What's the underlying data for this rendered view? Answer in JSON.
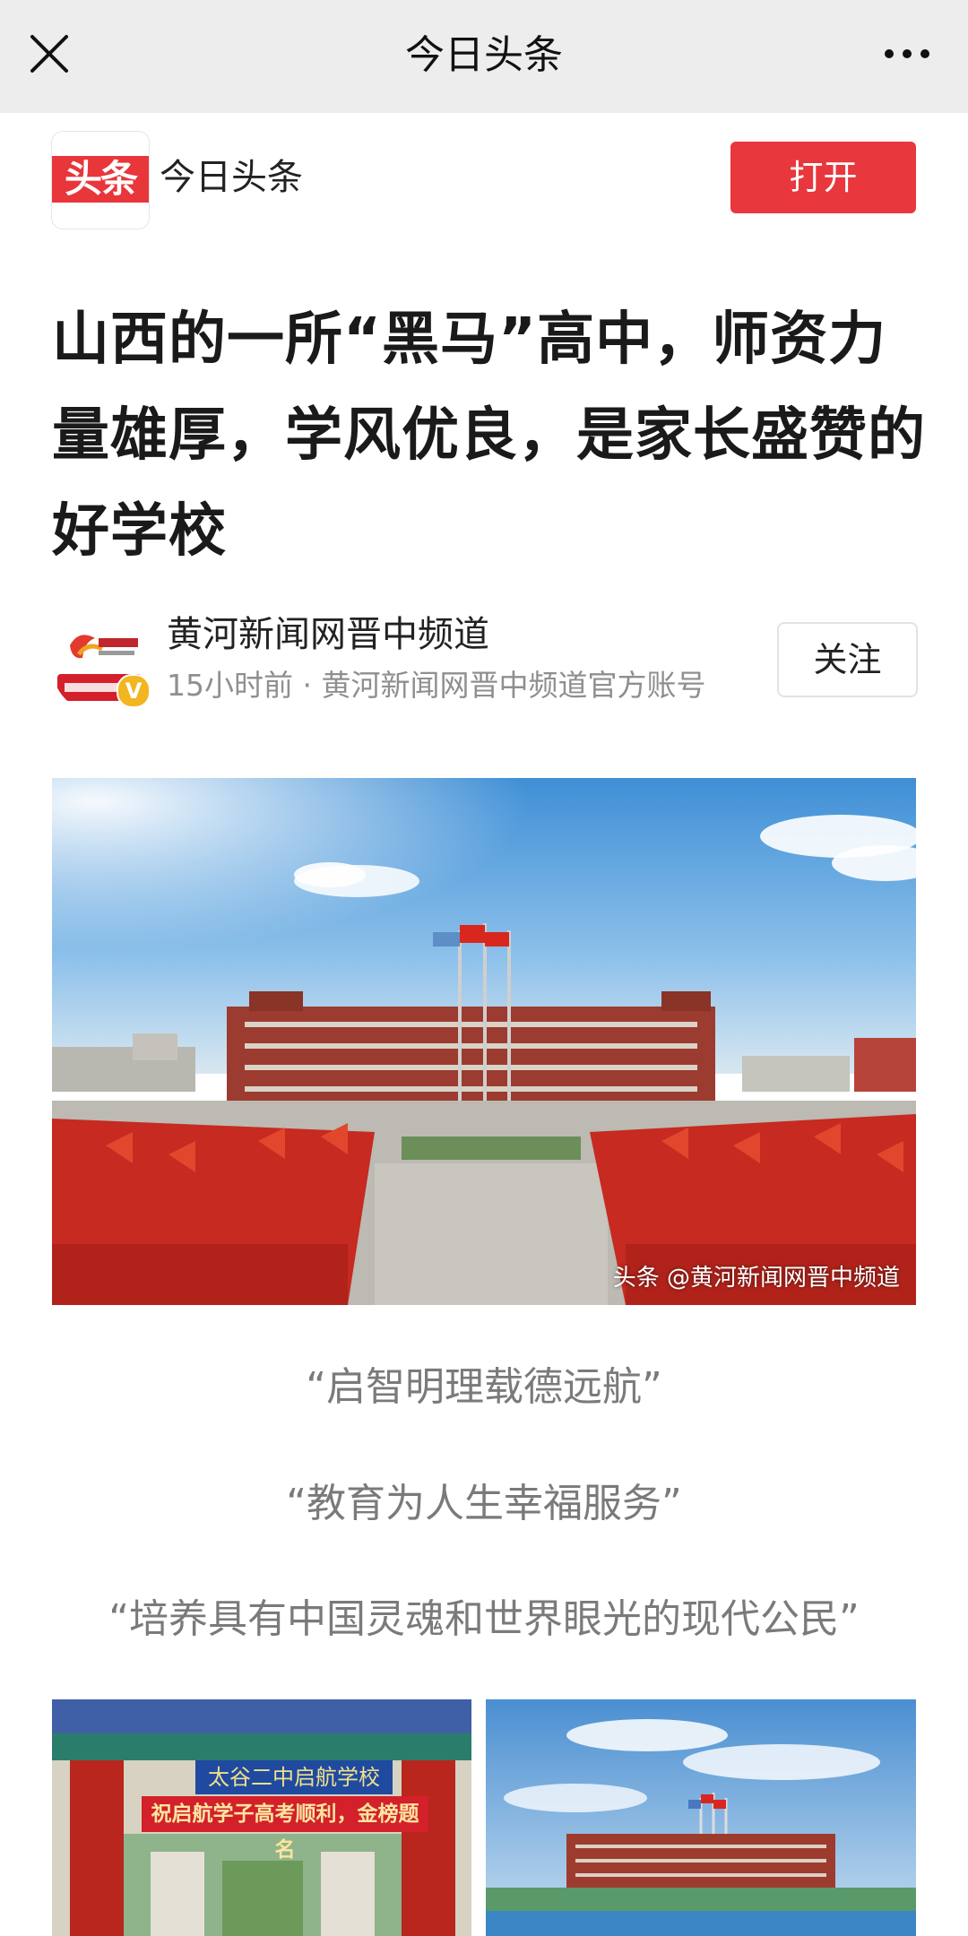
{
  "navbar": {
    "title": "今日头条",
    "close_icon": "close-icon",
    "more_icon": "more-horizontal-icon"
  },
  "app_banner": {
    "logo_text": "头条",
    "app_name": "今日头条",
    "open_label": "打开",
    "open_button_color": "#e8373d"
  },
  "article": {
    "title": "山西的一所“黑马”高中，师资力量雄厚，学风优良，是家长盛赞的好学校",
    "author": {
      "name": "黄河新闻网晋中频道",
      "meta": "15小时前 · 黄河新闻网晋中频道官方账号",
      "avatar_icon": "author-avatar-icon",
      "verified_icon": "verified-badge-icon",
      "verified_text": "V",
      "follow_label": "关注"
    },
    "main_image": {
      "watermark": "头条 @黄河新闻网晋中频道"
    },
    "quotes": [
      "“启智明理载德远航”",
      "“教育为人生幸福服务”",
      "“培养具有中国灵魂和世界眼光的现代公民”"
    ],
    "thumbnails": [
      {
        "sign_top": "太谷二中启航学校",
        "sign_banner": "祝启航学子高考顺利，金榜题名"
      },
      {
        "description_icon": "school-building-photo"
      }
    ]
  }
}
